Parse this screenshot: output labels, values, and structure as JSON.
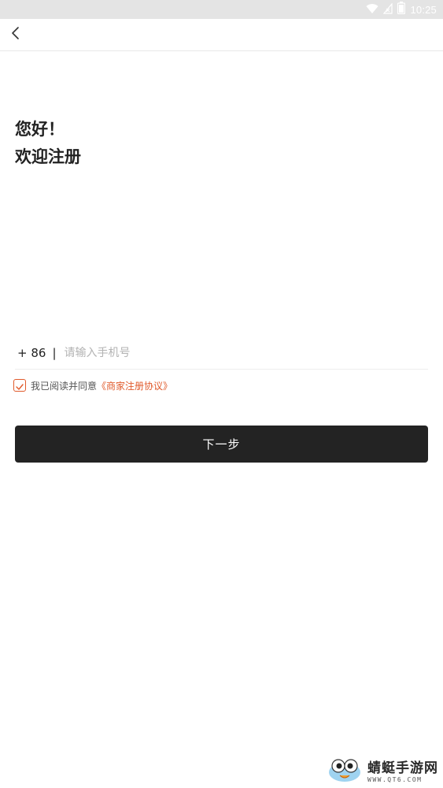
{
  "status_bar": {
    "time": "10:25",
    "icons": [
      "wifi-icon",
      "signal-icon",
      "battery-icon"
    ]
  },
  "header": {
    "back_icon": "chevron-left-icon"
  },
  "main": {
    "greeting": "您好！",
    "welcome": "欢迎注册"
  },
  "phone": {
    "country_code": "+ 86",
    "separator": "|",
    "placeholder": "请输入手机号",
    "value": ""
  },
  "agreement": {
    "checked": true,
    "text": "我已阅读并同意",
    "link": "《商家注册协议》"
  },
  "next_button": {
    "label": "下一步"
  },
  "watermark": {
    "title": "蜻蜓手游网",
    "url": "WWW.QT6.COM"
  },
  "colors": {
    "accent": "#e05a2b",
    "button_bg": "#232323",
    "status_bar_bg": "#e4e4e4"
  }
}
